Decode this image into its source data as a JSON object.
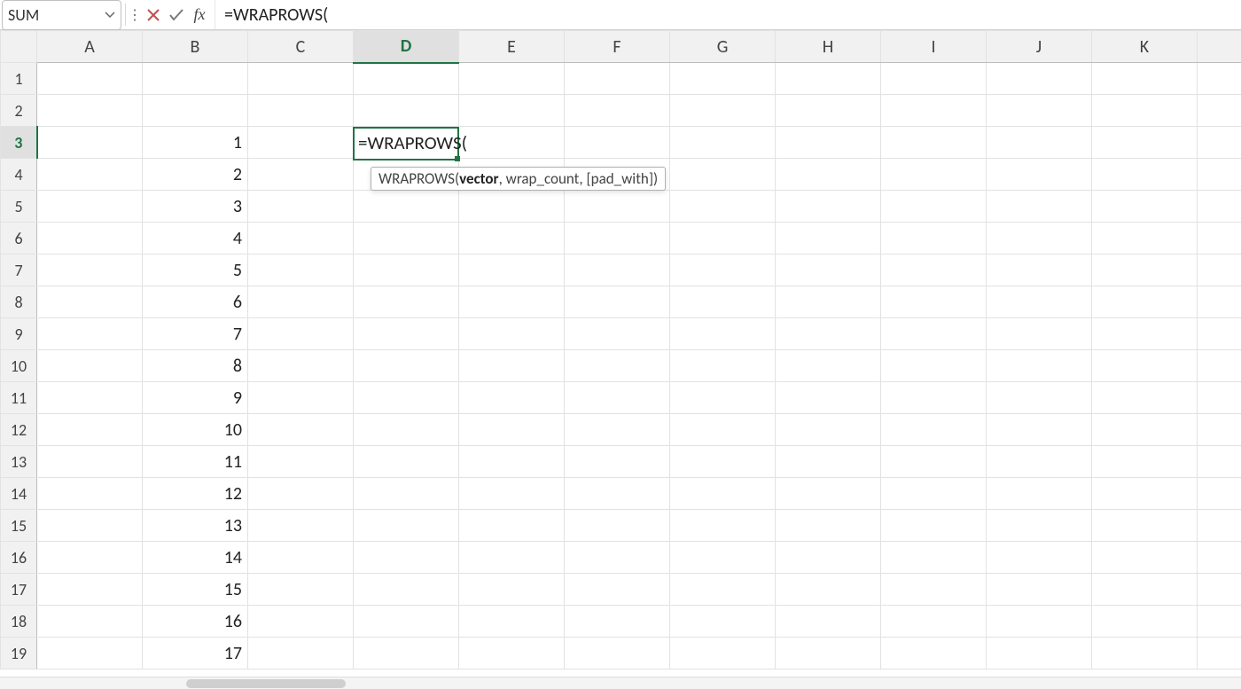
{
  "formula_bar": {
    "name_box_value": "SUM",
    "fx_label": "fx",
    "formula_text": "=WRAPROWS("
  },
  "columns": [
    "A",
    "B",
    "C",
    "D",
    "E",
    "F",
    "G",
    "H",
    "I",
    "J",
    "K"
  ],
  "active_column_index": 3,
  "rows": [
    1,
    2,
    3,
    4,
    5,
    6,
    7,
    8,
    9,
    10,
    11,
    12,
    13,
    14,
    15,
    16,
    17,
    18,
    19
  ],
  "active_row_index": 2,
  "col_b_values": {
    "3": "1",
    "4": "2",
    "5": "3",
    "6": "4",
    "7": "5",
    "8": "6",
    "9": "7",
    "10": "8",
    "11": "9",
    "12": "10",
    "13": "11",
    "14": "12",
    "15": "13",
    "16": "14",
    "17": "15",
    "18": "16",
    "19": "17"
  },
  "active_cell": {
    "ref": "D3",
    "editing_text": "=WRAPROWS("
  },
  "tooltip": {
    "fn": "WRAPROWS(",
    "current_arg": "vector",
    "rest": ", wrap_count, [pad_with])"
  }
}
